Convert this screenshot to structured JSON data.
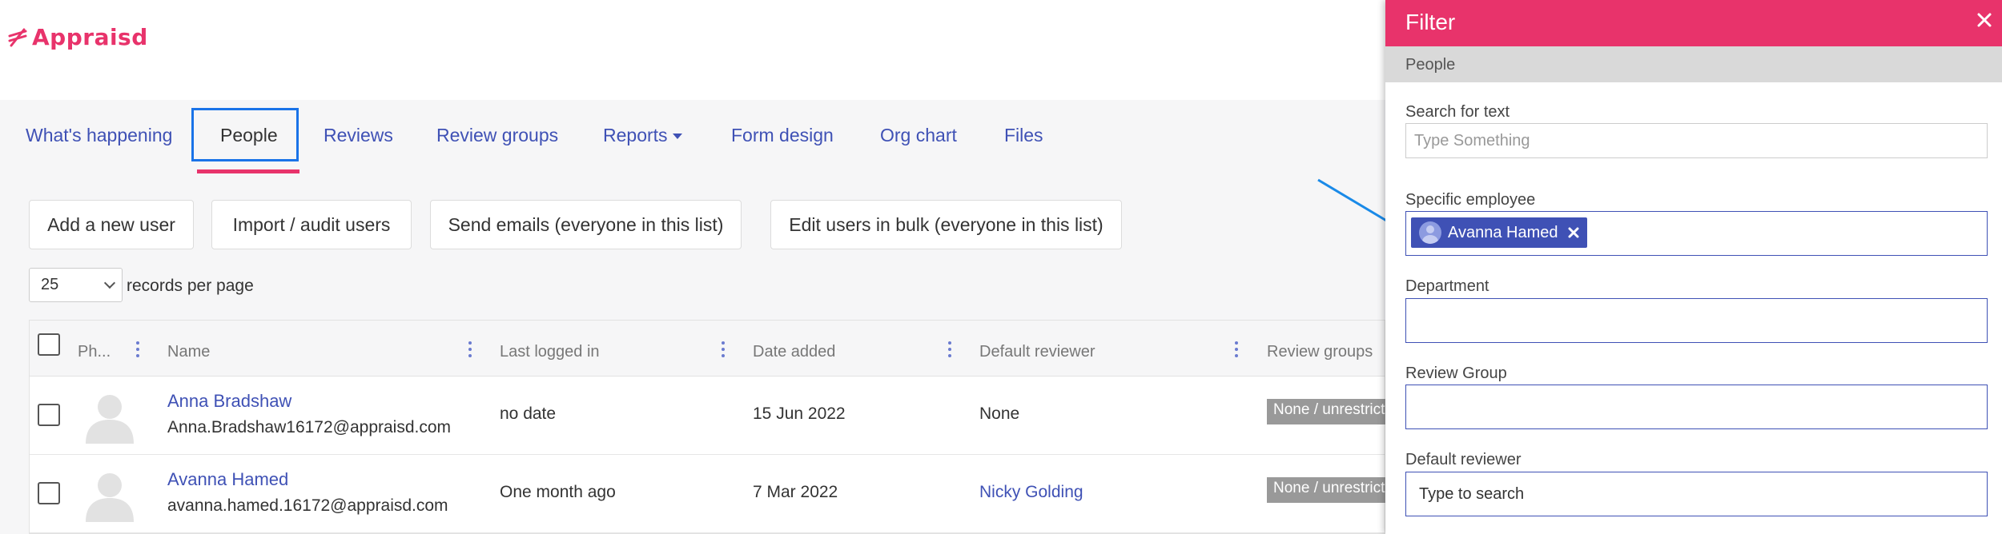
{
  "brand": {
    "logo_text": "Appraisd",
    "accent": "#e8336b",
    "link": "#3f51b5"
  },
  "nav": {
    "items": [
      {
        "label": "What's happening"
      },
      {
        "label": "People"
      },
      {
        "label": "Reviews"
      },
      {
        "label": "Review groups"
      },
      {
        "label": "Reports"
      },
      {
        "label": "Form design"
      },
      {
        "label": "Org chart"
      },
      {
        "label": "Files"
      }
    ],
    "active": "People"
  },
  "toolbar": {
    "add_user": "Add a new user",
    "import_users": "Import / audit users",
    "send_emails": "Send emails (everyone in this list)",
    "edit_bulk": "Edit users in bulk (everyone in this list)"
  },
  "paging": {
    "per_page_value": "25",
    "per_page_label": "records per page"
  },
  "table": {
    "columns": [
      "Ph...",
      "Name",
      "Last logged in",
      "Date added",
      "Default reviewer",
      "Review groups"
    ],
    "rows": [
      {
        "name": "Anna Bradshaw",
        "email": "Anna.Bradshaw16172@appraisd.com",
        "last_logged_in": "no date",
        "date_added": "15 Jun 2022",
        "default_reviewer": "None",
        "review_groups": "None / unrestricted"
      },
      {
        "name": "Avanna Hamed",
        "email": "avanna.hamed.16172@appraisd.com",
        "last_logged_in": "One month ago",
        "date_added": "7 Mar 2022",
        "default_reviewer": "Nicky Golding",
        "review_groups": "None / unrestricted"
      }
    ]
  },
  "filter": {
    "title": "Filter",
    "section": "People",
    "search_label": "Search for text",
    "search_placeholder": "Type Something",
    "employee_label": "Specific employee",
    "employee_tag": "Avanna Hamed",
    "department_label": "Department",
    "review_group_label": "Review Group",
    "reviewer_label": "Default reviewer",
    "reviewer_placeholder": "Type to search"
  }
}
